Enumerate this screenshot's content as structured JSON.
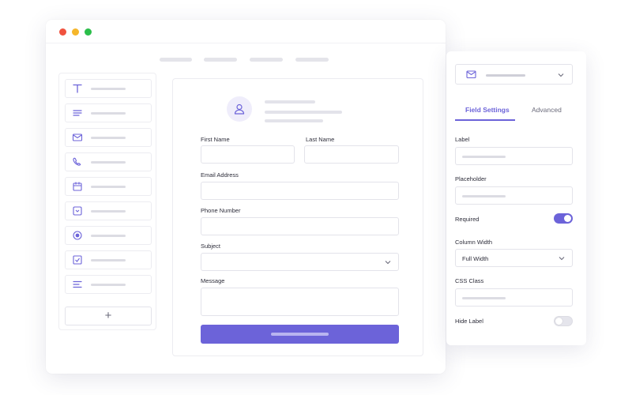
{
  "window": {
    "controls": [
      "close",
      "minimize",
      "maximize"
    ]
  },
  "palette": {
    "items": [
      {
        "icon": "text-t-icon"
      },
      {
        "icon": "paragraph-lines-icon"
      },
      {
        "icon": "envelope-icon"
      },
      {
        "icon": "phone-icon"
      },
      {
        "icon": "calendar-icon"
      },
      {
        "icon": "dropdown-box-icon"
      },
      {
        "icon": "radio-icon"
      },
      {
        "icon": "checkbox-icon"
      },
      {
        "icon": "align-lines-icon"
      }
    ],
    "add_label": "+"
  },
  "form": {
    "first_name_label": "First Name",
    "last_name_label": "Last Name",
    "email_label": "Email Address",
    "phone_label": "Phone Number",
    "subject_label": "Subject",
    "message_label": "Message"
  },
  "settings": {
    "tabs": [
      "Field Settings",
      "Advanced"
    ],
    "active_tab": "Field Settings",
    "label_label": "Label",
    "placeholder_label": "Placeholder",
    "required_label": "Required",
    "required_on": true,
    "column_width_label": "Column Width",
    "column_width_value": "Full Width",
    "css_class_label": "CSS Class",
    "hide_label_label": "Hide Label",
    "hide_label_on": false
  },
  "colors": {
    "accent": "#6c63d9",
    "close": "#f0523e",
    "minimize": "#f5b62b",
    "maximize": "#2bbe4a"
  }
}
